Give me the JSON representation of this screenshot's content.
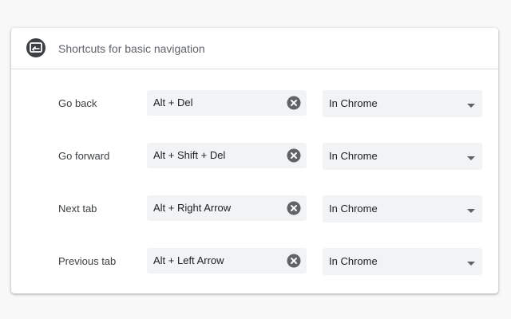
{
  "section": {
    "title": "Shortcuts for basic navigation",
    "icon": "keyboard-shortcut-icon"
  },
  "rows": [
    {
      "label": "Go back",
      "shortcut": "Alt + Del",
      "scope": "In Chrome"
    },
    {
      "label": "Go forward",
      "shortcut": "Alt + Shift + Del",
      "scope": "In Chrome"
    },
    {
      "label": "Next tab",
      "shortcut": "Alt + Right Arrow",
      "scope": "In Chrome"
    },
    {
      "label": "Previous tab",
      "shortcut": "Alt + Left Arrow",
      "scope": "In Chrome"
    }
  ],
  "colors": {
    "icon": "#3c4043",
    "field_bg": "#f1f3f4",
    "clear_icon": "#5f6368"
  }
}
